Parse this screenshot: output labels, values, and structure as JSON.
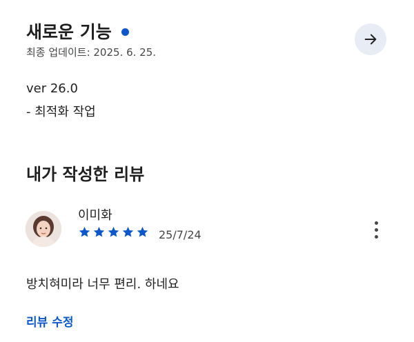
{
  "whats_new": {
    "title": "새로운 기능",
    "updated": "최종 업데이트: 2025. 6. 25.",
    "version": "ver 26.0",
    "note": "- 최적화 작업",
    "arrow_icon": "arrow-right-icon",
    "dot_color": "#0b57d0"
  },
  "my_review": {
    "title": "내가 작성한 리뷰",
    "reviewer": "이미화",
    "rating": 5,
    "date": "25/7/24",
    "text": "방치혀미라 너무 편리. 하네요",
    "edit_label": "리뷰 수정",
    "star_color": "#0b57d0",
    "more_icon": "more-vert-icon"
  }
}
